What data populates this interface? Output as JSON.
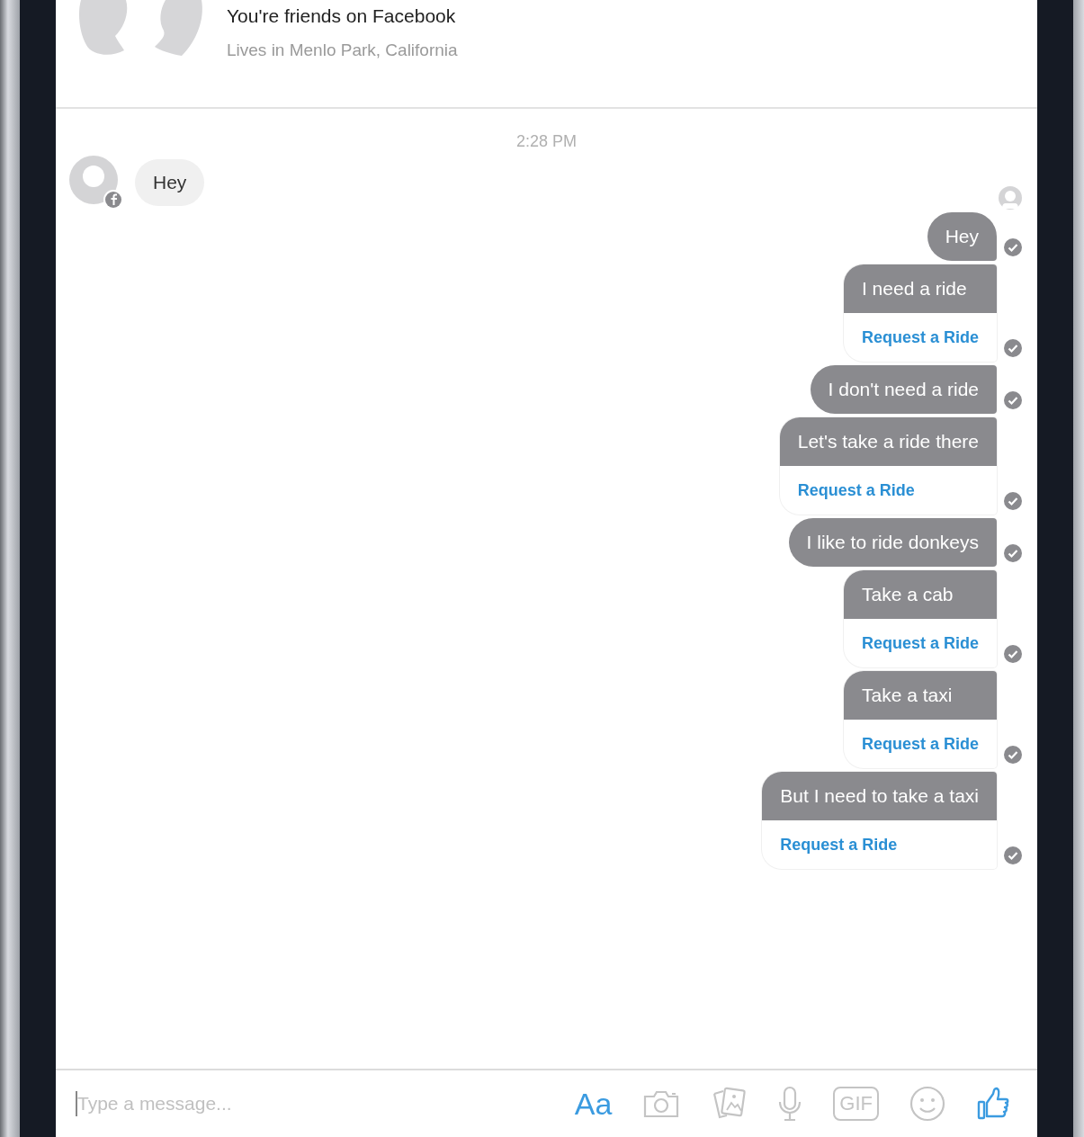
{
  "header": {
    "title": "You're friends on Facebook",
    "subtitle": "Lives in Menlo Park, California"
  },
  "timestamp": "2:28 PM",
  "incoming": [
    {
      "text": "Hey"
    }
  ],
  "outgoing": [
    {
      "kind": "text",
      "text": "Hey"
    },
    {
      "kind": "card",
      "text": "I need a ride",
      "action": "Request a Ride"
    },
    {
      "kind": "text",
      "text": "I don't need a ride"
    },
    {
      "kind": "card",
      "text": "Let's take a ride there",
      "action": "Request a Ride"
    },
    {
      "kind": "text",
      "text": "I like to ride donkeys"
    },
    {
      "kind": "card",
      "text": "Take a cab",
      "action": "Request a Ride"
    },
    {
      "kind": "card",
      "text": "Take a taxi",
      "action": "Request a Ride"
    },
    {
      "kind": "card",
      "text": "But I need to take a taxi",
      "action": "Request a Ride"
    }
  ],
  "composer": {
    "placeholder": "Type a message...",
    "format_label": "Aa",
    "gif_label": "GIF"
  }
}
